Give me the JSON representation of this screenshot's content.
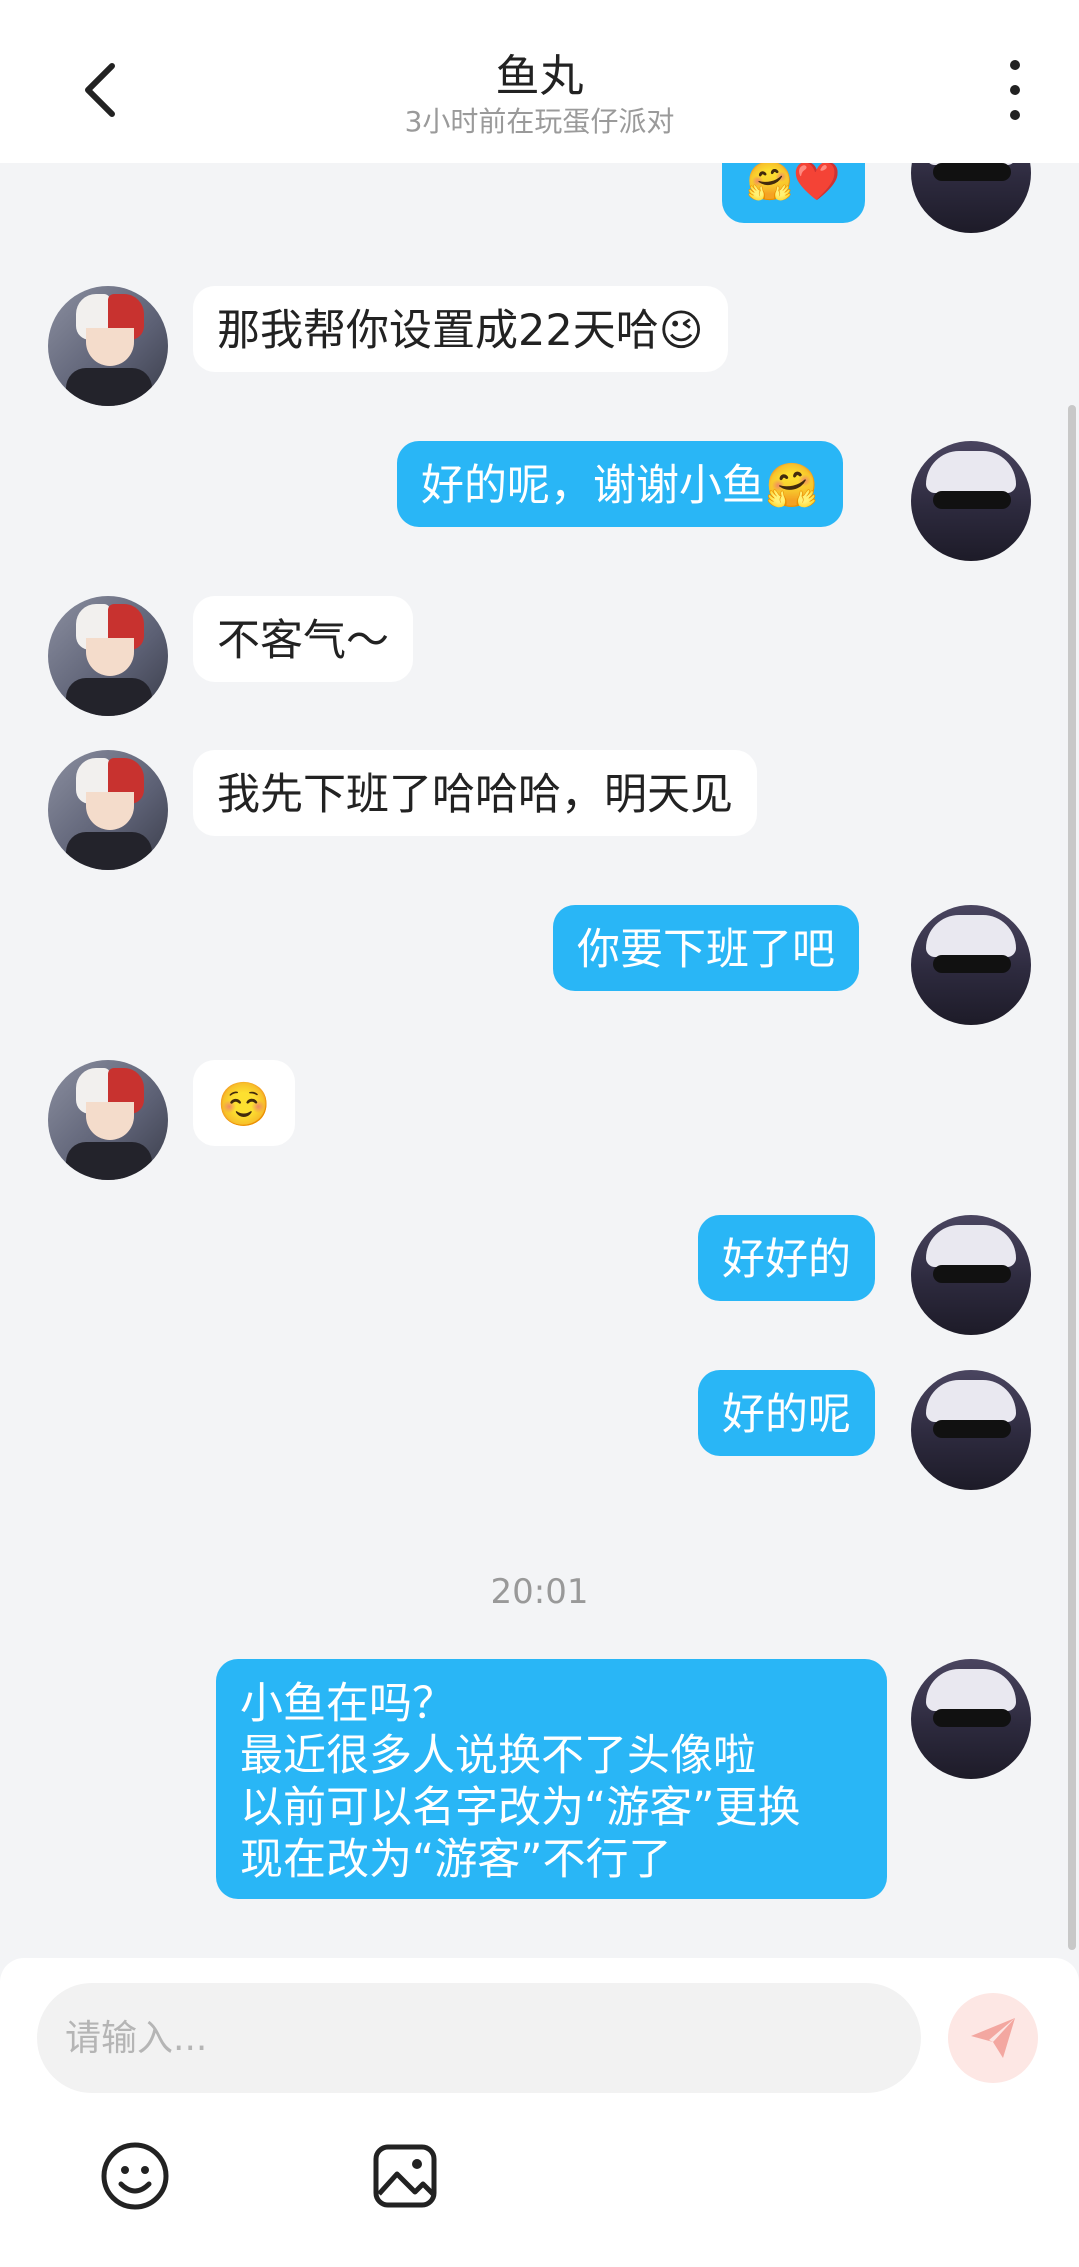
{
  "header": {
    "title": "鱼丸",
    "status": "3小时前在玩蛋仔派对"
  },
  "messages": [
    {
      "side": "out",
      "text": "🤗❤️"
    },
    {
      "side": "in",
      "text": "那我帮你设置成22天哈😉"
    },
    {
      "side": "out",
      "text": "好的呢，谢谢小鱼🤗"
    },
    {
      "side": "in",
      "text": "不客气～"
    },
    {
      "side": "in",
      "text": "我先下班了哈哈哈，明天见"
    },
    {
      "side": "out",
      "text": "你要下班了吧"
    },
    {
      "side": "in",
      "text": "☺️"
    },
    {
      "side": "out",
      "text": "好好的"
    },
    {
      "side": "out",
      "text": "好的呢"
    },
    {
      "side": "out",
      "text": "小鱼在吗？\n最近很多人说换不了头像啦\n以前可以名字改为“游客”更换\n现在改为“游客”不行了"
    }
  ],
  "timestamp": "20:01",
  "composer": {
    "placeholder": "请输入..."
  },
  "colors": {
    "outgoing_bubble": "#29b6f6",
    "incoming_bubble": "#ffffff",
    "background": "#f3f4f6",
    "send_button": "#fde7e4"
  },
  "icons": {
    "back": "chevron-left-icon",
    "more": "more-vertical-icon",
    "send": "paper-plane-icon",
    "emoji": "smiley-icon",
    "image": "image-icon"
  }
}
